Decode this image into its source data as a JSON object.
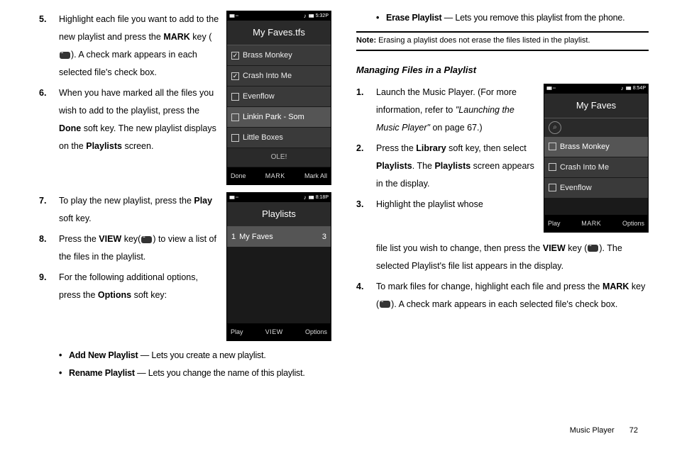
{
  "col1": {
    "step5": {
      "num": "5.",
      "text_a": "Highlight each file you want to add to the new playlist and press the ",
      "mark": "MARK",
      "text_b": " key (",
      "text_c": "). A check mark appears in each selected file's check box."
    },
    "step6": {
      "num": "6.",
      "text_a": "When you have marked all the files you wish to add to the playlist, press the ",
      "done": "Done",
      "text_b": " soft key. The new playlist displays on the ",
      "playlists": "Playlists",
      "text_c": " screen."
    },
    "step7": {
      "num": "7.",
      "text_a": "To play the new playlist, press the ",
      "play": "Play",
      "text_b": " soft key."
    },
    "step8": {
      "num": "8.",
      "text_a": "Press the ",
      "view": "VIEW",
      "text_b": " key(",
      "text_c": ") to view a list of the files in the playlist."
    },
    "step9": {
      "num": "9.",
      "text_a": "For the following additional options, press the ",
      "options": "Options",
      "text_b": " soft key:"
    },
    "bullets": {
      "add": {
        "label": "Add New Playlist",
        "desc": " — Lets you create a new playlist."
      },
      "rename": {
        "label": "Rename Playlist",
        "desc": " — Lets you change the name of this playlist."
      }
    }
  },
  "col2": {
    "bullets": {
      "erase": {
        "label": "Erase Playlist",
        "desc": " — Lets you remove this playlist from the phone."
      }
    },
    "note": {
      "label": "Note:",
      "text": " Erasing a playlist does not erase the files listed in the playlist."
    },
    "heading": "Managing Files in a Playlist",
    "step1": {
      "num": "1.",
      "text_a": "Launch the Music Player. (For more information, refer to ",
      "ref": "\"Launching the Music Player\"",
      "text_b": " on page 67.)"
    },
    "step2": {
      "num": "2.",
      "text_a": "Press the ",
      "library": "Library",
      "text_b": " soft key, then select ",
      "playlists1": "Playlists",
      "text_c": ". The ",
      "playlists2": "Playlists",
      "text_d": " screen appears in the display."
    },
    "step3": {
      "num": "3.",
      "text_a": "Highlight the playlist whose file list you wish to change, then press the ",
      "view": "VIEW",
      "text_b": " key (",
      "text_c": "). The selected Playlist's file list appears in the display."
    },
    "step4": {
      "num": "4.",
      "text_a": "To mark files for change, highlight each file and press the ",
      "mark": "MARK",
      "text_b": " key (",
      "text_c": "). A check mark appears in each selected file's check box."
    }
  },
  "phones": {
    "faves_tfs": {
      "time": "5:32P",
      "title": "My Faves.tfs",
      "rows": [
        {
          "label": "Brass Monkey",
          "checked": true
        },
        {
          "label": "Crash Into Me",
          "checked": true
        },
        {
          "label": "Evenflow",
          "checked": false
        },
        {
          "label": "Linkin Park - Som",
          "checked": false,
          "highlighted": true
        },
        {
          "label": "Little Boxes",
          "checked": false
        }
      ],
      "footer_label": "OLE!",
      "softkeys": [
        "Done",
        "MARK",
        "Mark All"
      ]
    },
    "playlists": {
      "time": "8:18P",
      "title": "Playlists",
      "row_num": "1",
      "row_label": "My Faves",
      "row_count": "3",
      "softkeys": [
        "Play",
        "VIEW",
        "Options"
      ]
    },
    "my_faves": {
      "time": "8:54P",
      "title": "My Faves",
      "rows": [
        {
          "label": "Brass Monkey",
          "highlighted": true
        },
        {
          "label": "Crash Into Me"
        },
        {
          "label": "Evenflow"
        }
      ],
      "softkeys": [
        "Play",
        "MARK",
        "Options"
      ]
    }
  },
  "footer": {
    "label": "Music Player",
    "page": "72"
  }
}
